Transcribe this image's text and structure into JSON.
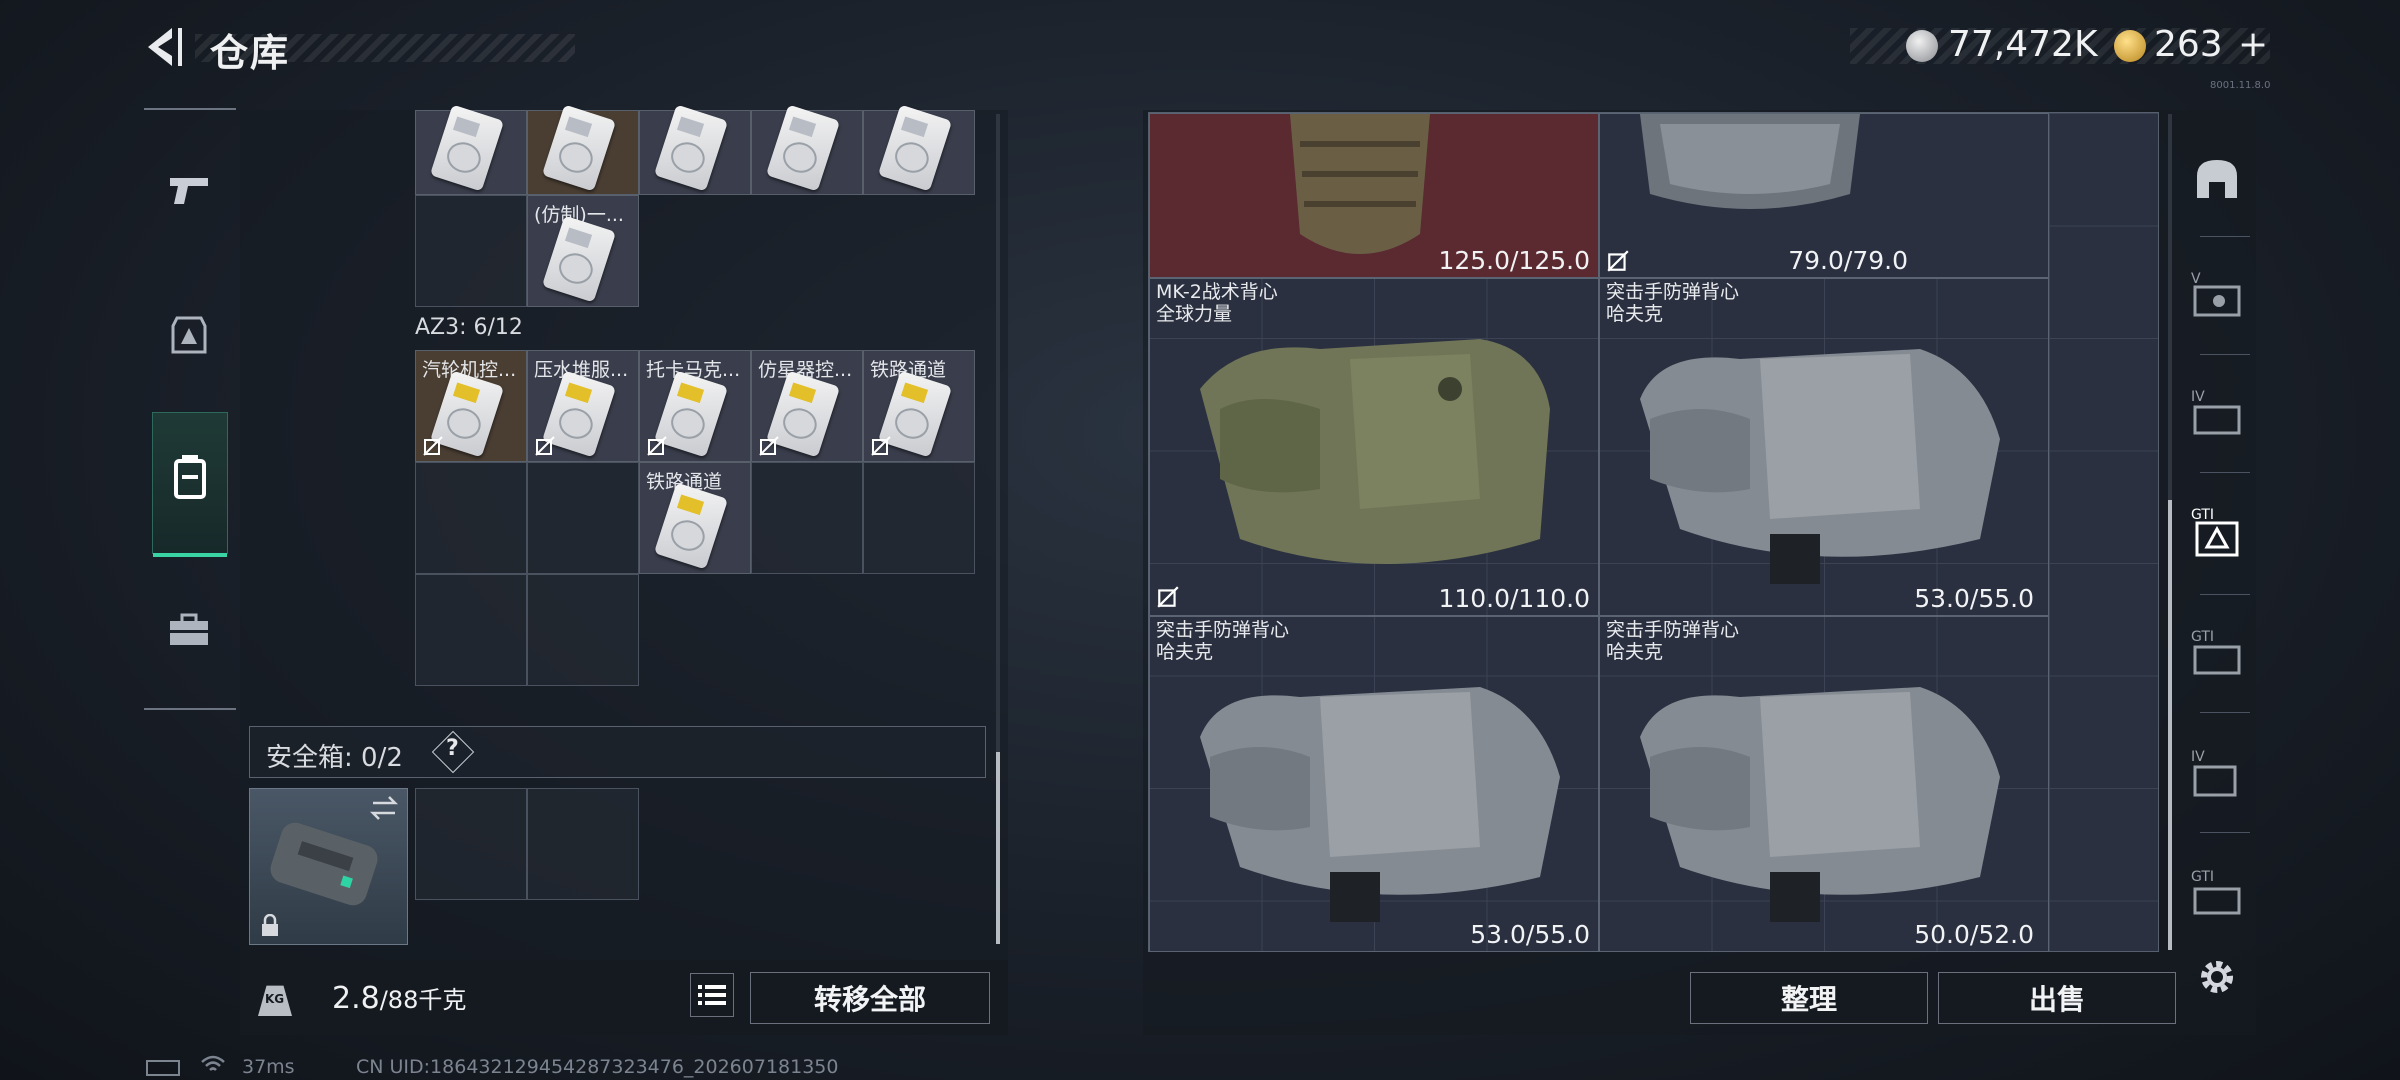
{
  "header": {
    "title": "仓库",
    "currency_1": "77,472K",
    "currency_2": "263",
    "add_symbol": "+",
    "version": "8001.11.8.0"
  },
  "left_rail": {
    "items": [
      "weapon-icon",
      "armor-icon",
      "backpack-icon",
      "case-icon"
    ],
    "active_index": 2
  },
  "inventory": {
    "top_row_items": [
      {
        "label": ""
      },
      {
        "label": ""
      },
      {
        "label": ""
      },
      {
        "label": ""
      },
      {
        "label": ""
      }
    ],
    "extra_item_label": "(仿制)一...",
    "az3_label": "AZ3: 6/12",
    "az3_items": [
      "汽轮机控...",
      "压水堆服...",
      "托卡马克...",
      "仿星器控...",
      "铁路通道"
    ],
    "az3_row2_item": "铁路通道"
  },
  "safebox": {
    "label": "安全箱: 0/2",
    "help": "?"
  },
  "weight": {
    "current": "2.8",
    "capacity": "/88千克",
    "unit_icon": "KG"
  },
  "buttons": {
    "transfer_all": "转移全部",
    "sort": "整理",
    "sell": "出售"
  },
  "stash": {
    "vests": [
      {
        "name": "",
        "durability": "125.0/125.0",
        "bg": "#5a2a30"
      },
      {
        "name": "",
        "durability": "79.0/79.0",
        "bg": "#2a3040"
      },
      {
        "name": "MK-2战术背心\n全球力量",
        "durability": "110.0/110.0",
        "bg": "#2a3040"
      },
      {
        "name": "突击手防弹背心\n哈夫克",
        "durability": "53.0/55.0",
        "bg": "#2a3040"
      },
      {
        "name": "突击手防弹背心\n哈夫克",
        "durability": "53.0/55.0",
        "bg": "#2a3040"
      },
      {
        "name": "突击手防弹背心\n哈夫克",
        "durability": "50.0/52.0",
        "bg": "#2a3040"
      }
    ]
  },
  "side_tabs": [
    "helmet-icon",
    "vest-tab-5-icon",
    "vest-tab-4-icon",
    "vest-tab-3-icon",
    "vest-tab-3b-icon",
    "vest-tab-4b-icon",
    "vest-tab-3c-icon"
  ],
  "status": {
    "ping": "37ms",
    "uid": "CN UID:186432129454287323476_202607181350"
  },
  "colors": {
    "accent": "#39d3a4",
    "danger_bg": "#5a2a30"
  }
}
